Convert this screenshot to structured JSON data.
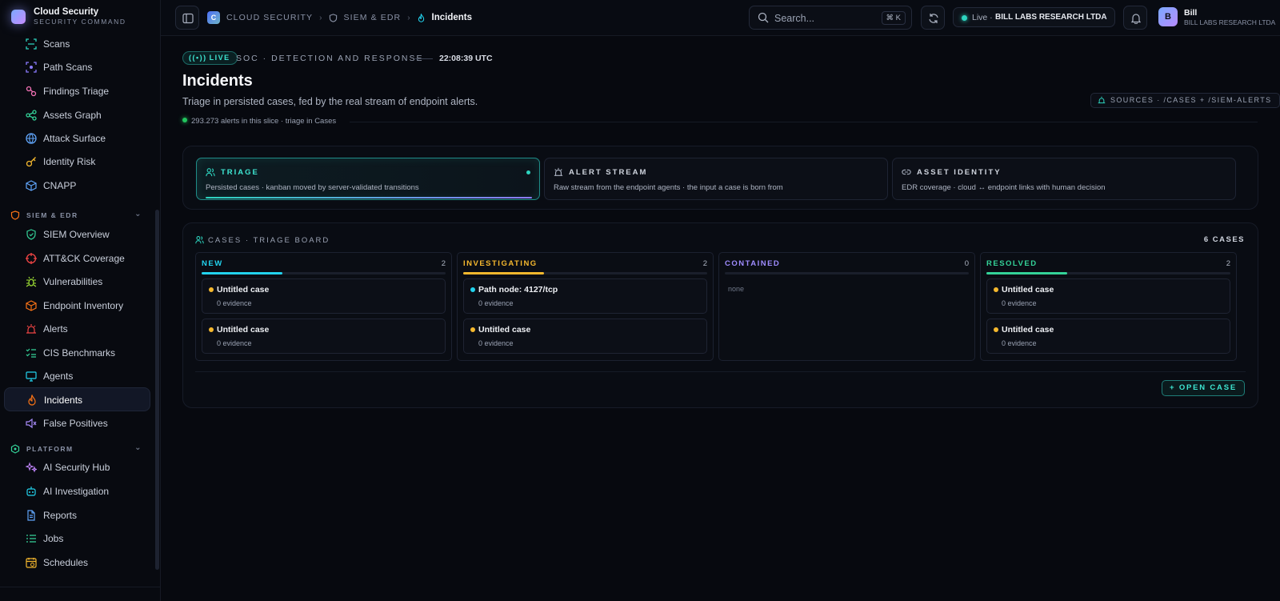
{
  "brand": {
    "title": "Cloud Security",
    "subtitle": "SECURITY COMMAND"
  },
  "sidebar": {
    "items_top": [
      {
        "label": "Scans",
        "icon": "scan-icon"
      },
      {
        "label": "Path Scans",
        "icon": "path-scan-icon"
      },
      {
        "label": "Findings Triage",
        "icon": "findings-icon"
      },
      {
        "label": "Assets Graph",
        "icon": "graph-icon"
      },
      {
        "label": "Attack Surface",
        "icon": "globe-icon"
      },
      {
        "label": "Identity Risk",
        "icon": "key-icon"
      },
      {
        "label": "CNAPP",
        "icon": "cube-icon"
      }
    ],
    "group_siem": "SIEM & EDR",
    "items_siem": [
      {
        "label": "SIEM Overview",
        "icon": "shield-check-icon"
      },
      {
        "label": "ATT&CK Coverage",
        "icon": "target-icon"
      },
      {
        "label": "Vulnerabilities",
        "icon": "bug-icon"
      },
      {
        "label": "Endpoint Inventory",
        "icon": "box-icon"
      },
      {
        "label": "Alerts",
        "icon": "siren-icon"
      },
      {
        "label": "CIS Benchmarks",
        "icon": "checklist-icon"
      },
      {
        "label": "Agents",
        "icon": "monitor-icon"
      },
      {
        "label": "Incidents",
        "icon": "flame-icon"
      },
      {
        "label": "False Positives",
        "icon": "mute-icon"
      }
    ],
    "group_platform": "PLATFORM",
    "items_platform": [
      {
        "label": "AI Security Hub",
        "icon": "sparkles-icon"
      },
      {
        "label": "AI Investigation",
        "icon": "bot-icon"
      },
      {
        "label": "Reports",
        "icon": "file-icon"
      },
      {
        "label": "Jobs",
        "icon": "list-icon"
      },
      {
        "label": "Schedules",
        "icon": "calendar-icon"
      }
    ]
  },
  "topbar": {
    "crumb_badge": "C",
    "crumb_1": "CLOUD SECURITY",
    "crumb_2": "SIEM & EDR",
    "crumb_current": "Incidents",
    "search_placeholder": "Search...",
    "search_kbd": "⌘ K",
    "tenant_live": "Live ·",
    "tenant_name": "BILL LABS RESEARCH LTDA",
    "user_initial": "B",
    "user_name": "Bill",
    "user_org": "BILL LABS RESEARCH LTDA"
  },
  "header": {
    "live_badge": "LIVE",
    "eyebrow": "SOC · DETECTION AND RESPONSE",
    "clock": "22:08:39 UTC",
    "title": "Incidents",
    "subtitle": "Triage in persisted cases, fed by the real stream of endpoint alerts.",
    "meta": "293.273 alerts in this slice · triage in Cases",
    "sources": "SOURCES · /CASES + /SIEM-ALERTS"
  },
  "tabs": [
    {
      "title": "TRIAGE",
      "desc": "Persisted cases · kanban moved by server-validated transitions"
    },
    {
      "title": "ALERT STREAM",
      "desc": "Raw stream from the endpoint agents · the input a case is born from"
    },
    {
      "title": "ASSET IDENTITY",
      "desc": "EDR coverage · cloud ↔ endpoint links with human decision"
    }
  ],
  "board": {
    "title": "CASES · TRIAGE BOARD",
    "count": "6 CASES",
    "columns": [
      {
        "title": "NEW",
        "count": "2",
        "color": "#22d3ee",
        "fill": 0.33,
        "cards": [
          {
            "title": "Untitled case",
            "evidence": "0 evidence",
            "dot": "#f5b82e"
          },
          {
            "title": "Untitled case",
            "evidence": "0 evidence",
            "dot": "#f5b82e"
          }
        ]
      },
      {
        "title": "INVESTIGATING",
        "count": "2",
        "color": "#f5b82e",
        "fill": 0.33,
        "cards": [
          {
            "title": "Path node: 4127/tcp",
            "evidence": "0 evidence",
            "dot": "#22d3ee"
          },
          {
            "title": "Untitled case",
            "evidence": "0 evidence",
            "dot": "#f5b82e"
          }
        ]
      },
      {
        "title": "CONTAINED",
        "count": "0",
        "color": "#9f8cff",
        "fill": 0,
        "empty": "none",
        "cards": []
      },
      {
        "title": "RESOLVED",
        "count": "2",
        "color": "#34d399",
        "fill": 0.33,
        "cards": [
          {
            "title": "Untitled case",
            "evidence": "0 evidence",
            "dot": "#f5b82e"
          },
          {
            "title": "Untitled case",
            "evidence": "0 evidence",
            "dot": "#f5b82e"
          }
        ]
      }
    ],
    "open_case": "+  OPEN CASE"
  }
}
